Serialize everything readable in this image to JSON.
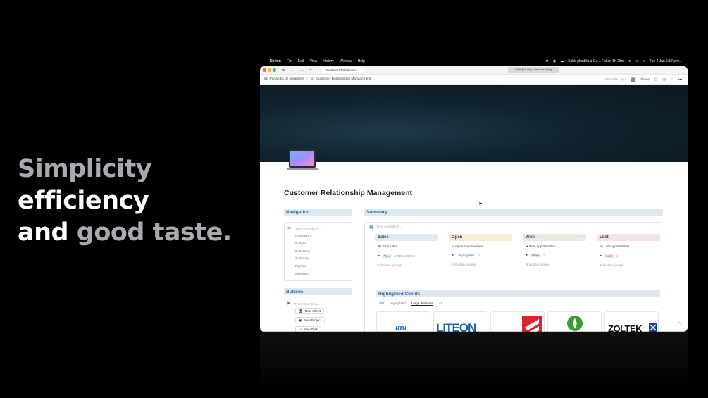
{
  "tagline": {
    "line1": "Simplicity",
    "line2": "efficiency",
    "line3a": "and ",
    "line3b": "good taste."
  },
  "menubar": {
    "app": "Notion",
    "items": [
      "File",
      "Edit",
      "View",
      "History",
      "Window",
      "Help"
    ],
    "status_text": "Subir plantilla a Gu... Faltan 1h 28m",
    "datetime": "Tue 4 Jun  5:17 p.m.",
    "tooltip": "Click ◉ to stop screen recording"
  },
  "browser": {
    "tab_title": "Customer Relationsh..."
  },
  "topbar": {
    "crumb1": "Portafolio de templates",
    "crumb2": "Customer Relationship Management",
    "edited": "Edited 6m ago",
    "share": "Share"
  },
  "page": {
    "title": "Customer Relationship Management"
  },
  "navigation": {
    "heading": "Navigation",
    "placeholder": "Type something...",
    "items": [
      "Navigation",
      "Buttons",
      "Data Base",
      "Summary",
      "Pipeline",
      "Meetings"
    ]
  },
  "buttons_section": {
    "heading": "Buttons",
    "placeholder": "Type something...",
    "items": [
      "New Client",
      "New Project",
      "New Task"
    ]
  },
  "summary": {
    "heading": "Summary",
    "placeholder": "Type something...",
    "columns": [
      {
        "title": "Sales",
        "prop": "Total sales",
        "row_label": "W...",
        "row_value": "MX$50,000.00",
        "hidden": "6 hidden groups",
        "color": "#dfe9f3",
        "pill_bg": "#dbeddb",
        "pill_fg": "#2f7a3e"
      },
      {
        "title": "Open",
        "prop": "Open opportunities",
        "row_label": "In progress",
        "row_value": "2",
        "hidden": "2 hidden groups",
        "color": "#f6ecd8",
        "pill_bg": "#ffffff",
        "pill_fg": "#2e6aa3"
      },
      {
        "title": "Won",
        "prop": "Won opportunities",
        "row_label": "Won",
        "row_value": "1",
        "hidden": "6 hidden groups",
        "color": "#e3eee0",
        "pill_bg": "#dbeddb",
        "pill_fg": "#2f7a3e"
      },
      {
        "title": "Lost",
        "prop": "Lost opportunities",
        "row_label": "Lost",
        "row_value": "1",
        "hidden": "6 hidden groups",
        "color": "#f8e2e2",
        "pill_bg": "#fbe4e4",
        "pill_fg": "#b33a3a"
      }
    ]
  },
  "clients": {
    "heading": "Highlighted Clients",
    "views": [
      "VIP",
      "Highlighted",
      "Large Bussines",
      "All"
    ],
    "active_view": "Large Bussines",
    "logos": [
      "imi",
      "LITEON",
      "",
      "",
      "ZOLTEK"
    ]
  },
  "colors": {
    "accent": "#2e6aa3",
    "heading_bg": "#dde8f0",
    "cover": "#10232e"
  }
}
